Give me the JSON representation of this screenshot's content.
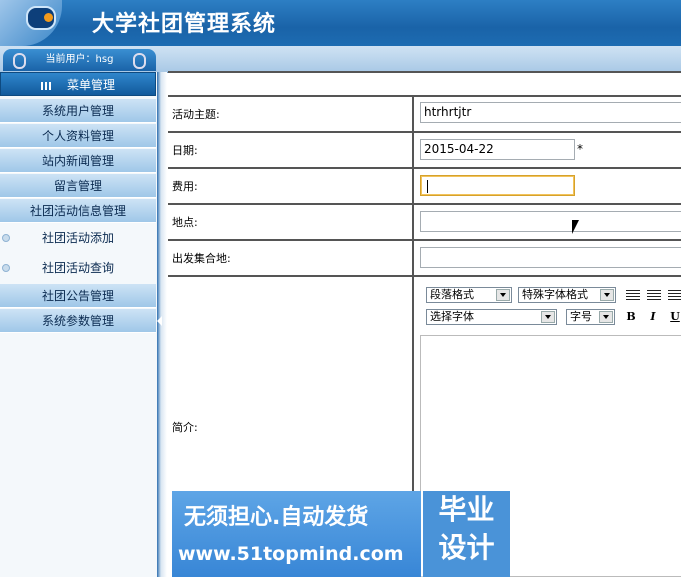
{
  "app": {
    "title": "大学社团管理系统"
  },
  "user": {
    "label": "当前用户：hsg"
  },
  "sidebar": {
    "header": "菜单管理",
    "items": [
      {
        "label": "系统用户管理"
      },
      {
        "label": "个人资料管理"
      },
      {
        "label": "站内新闻管理"
      },
      {
        "label": "留言管理"
      },
      {
        "label": "社团活动信息管理"
      }
    ],
    "subitems": [
      {
        "label": "社团活动添加"
      },
      {
        "label": "社团活动查询"
      }
    ],
    "items2": [
      {
        "label": "社团公告管理"
      },
      {
        "label": "系统参数管理"
      }
    ]
  },
  "form": {
    "topic": {
      "label": "活动主题:",
      "value": "htrhrtjtr"
    },
    "date": {
      "label": "日期:",
      "value": "2015-04-22",
      "required_mark": "*"
    },
    "fee": {
      "label": "费用:",
      "value": ""
    },
    "location": {
      "label": "地点:",
      "value": ""
    },
    "meeting_point": {
      "label": "出发集合地:",
      "value": ""
    },
    "intro": {
      "label": "简介:"
    }
  },
  "editor": {
    "paragraph_format": "段落格式",
    "special_font_format": "特殊字体格式",
    "font_select": "选择字体",
    "font_size": "字号",
    "bold": "B",
    "italic": "I",
    "underline": "U"
  },
  "watermark": {
    "line1": "无须担心.自动发货",
    "line2": "www.51topmind.com",
    "badge_line1": "毕业",
    "badge_line2": "设计"
  }
}
